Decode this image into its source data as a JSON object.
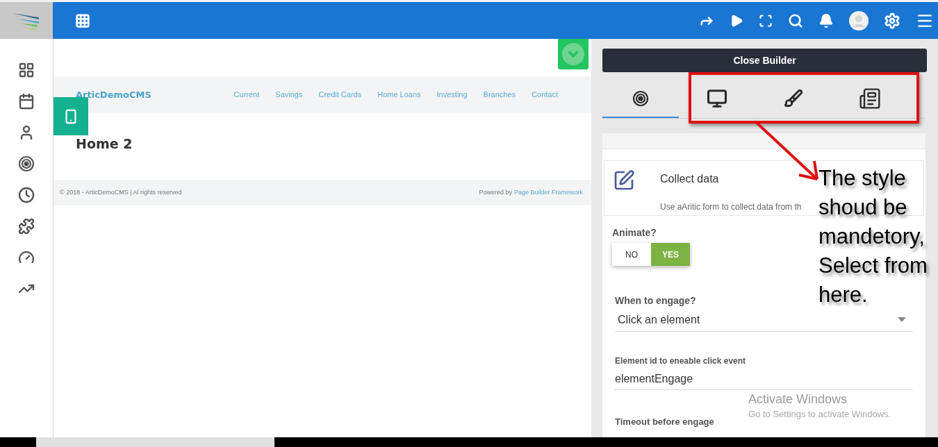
{
  "preview": {
    "brand": "ArticDemoCMS",
    "nav": [
      "Current",
      "Savings",
      "Credit Cards",
      "Home Loans",
      "Investing",
      "Branches",
      "Contact"
    ],
    "heading": "Home 2",
    "footer_left": "© 2018 - ArticDemoCMS | Al rights reserved",
    "footer_powered": "Powered by",
    "footer_link": "Page Builder Framework"
  },
  "builder": {
    "close_button": "Close Builder",
    "tabs": [
      {
        "kind": "target",
        "selected": true
      },
      {
        "kind": "monitor",
        "selected": false
      },
      {
        "kind": "brush",
        "selected": false
      },
      {
        "kind": "newspaper",
        "selected": false
      }
    ],
    "block": {
      "title": "Collect data",
      "description": "Use aAritic form to collect data from th"
    },
    "animate": {
      "label": "Animate?",
      "options": [
        {
          "label": "NO",
          "selected": false
        },
        {
          "label": "YES",
          "selected": true
        }
      ]
    },
    "engage": {
      "label": "When to engage?",
      "value": "Click an element"
    },
    "element_id": {
      "label": "Element id to eneable click event",
      "value": "elementEngage"
    },
    "timeout": {
      "label": "Timeout before engage"
    }
  },
  "annotation": {
    "text": "The style shoud be mandetory, Select from here."
  },
  "os_notice": {
    "title": "Activate Windows",
    "subtitle": "Go to Settings to activate Windows."
  }
}
